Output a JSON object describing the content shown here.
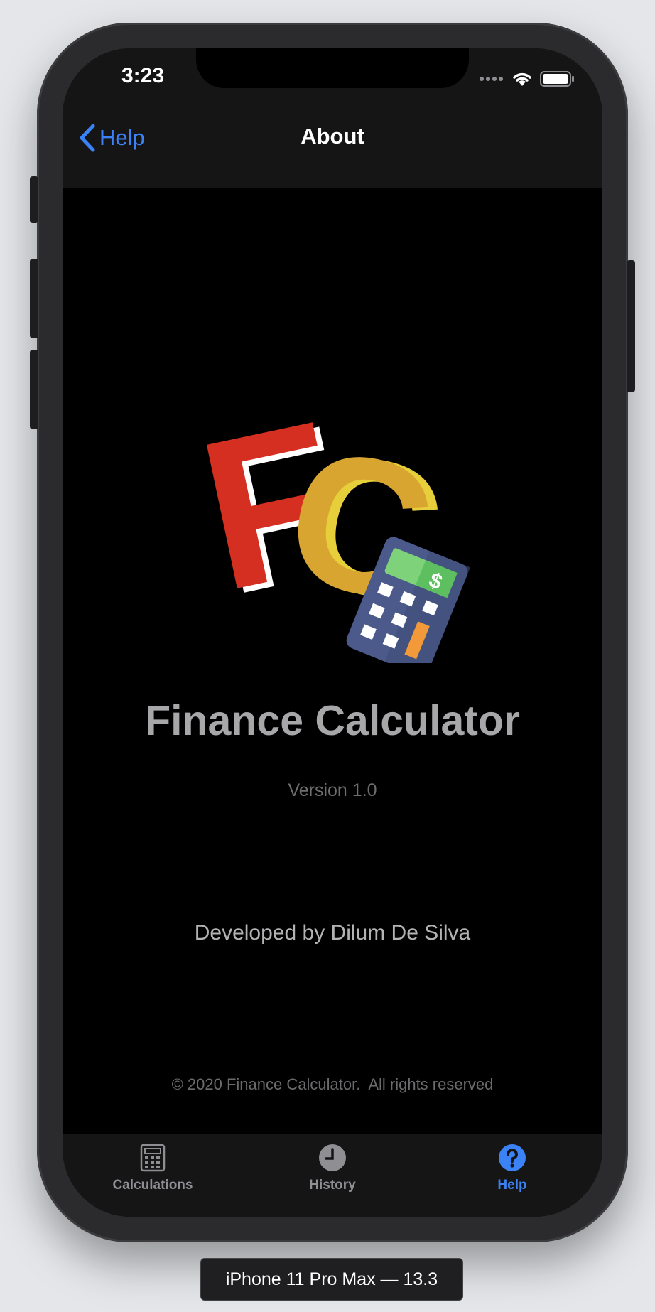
{
  "status_bar": {
    "time": "3:23"
  },
  "nav": {
    "back_label": "Help",
    "title": "About"
  },
  "logo": {
    "letters": "FC",
    "calculator_symbol": "$"
  },
  "content": {
    "app_name": "Finance Calculator",
    "version": "Version 1.0",
    "developer": "Developed by Dilum De Silva",
    "copyright": "© 2020 Finance Calculator.  All rights reserved"
  },
  "tabs": [
    {
      "label": "Calculations",
      "icon": "calculator-icon",
      "active": false
    },
    {
      "label": "History",
      "icon": "clock-icon",
      "active": false
    },
    {
      "label": "Help",
      "icon": "question-circle-icon",
      "active": true
    }
  ],
  "device": {
    "label": "iPhone 11 Pro Max — 13.3"
  },
  "colors": {
    "accent": "#3b82f6",
    "background": "#000000",
    "bar": "#151516"
  }
}
